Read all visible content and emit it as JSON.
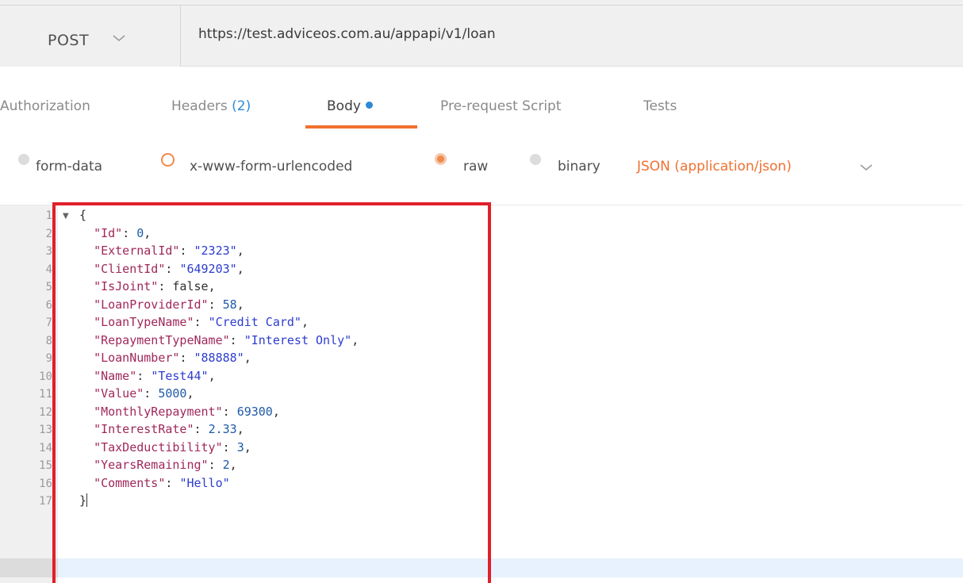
{
  "request": {
    "method": "POST",
    "url": "https://test.adviceos.com.au/appapi/v1/loan"
  },
  "tabs": [
    {
      "label": "Authorization"
    },
    {
      "label": "Headers",
      "count": "(2)"
    },
    {
      "label": "Body",
      "active": true
    },
    {
      "label": "Pre-request Script"
    },
    {
      "label": "Tests"
    }
  ],
  "body_types": {
    "form_data": "form-data",
    "urlencoded": "x-www-form-urlencoded",
    "raw": "raw",
    "binary": "binary",
    "selected": "raw",
    "content_type": "JSON (application/json)"
  },
  "editor": {
    "active_line": 17,
    "lines": [
      {
        "n": "1",
        "text": "{"
      },
      {
        "n": "2",
        "key": "\"Id\"",
        "value": "0",
        "type": "num",
        "comma": true
      },
      {
        "n": "3",
        "key": "\"ExternalId\"",
        "value": "\"2323\"",
        "type": "str",
        "comma": true
      },
      {
        "n": "4",
        "key": "\"ClientId\"",
        "value": "\"649203\"",
        "type": "str",
        "comma": true
      },
      {
        "n": "5",
        "key": "\"IsJoint\"",
        "value": "false",
        "type": "kw",
        "comma": true
      },
      {
        "n": "6",
        "key": "\"LoanProviderId\"",
        "value": "58",
        "type": "num",
        "comma": true
      },
      {
        "n": "7",
        "key": "\"LoanTypeName\"",
        "value": "\"Credit Card\"",
        "type": "str",
        "comma": true
      },
      {
        "n": "8",
        "key": "\"RepaymentTypeName\"",
        "value": "\"Interest Only\"",
        "type": "str",
        "comma": true
      },
      {
        "n": "9",
        "key": "\"LoanNumber\"",
        "value": "\"88888\"",
        "type": "str",
        "comma": true
      },
      {
        "n": "10",
        "key": "\"Name\"",
        "value": "\"Test44\"",
        "type": "str",
        "comma": true
      },
      {
        "n": "11",
        "key": "\"Value\"",
        "value": "5000",
        "type": "num",
        "comma": true
      },
      {
        "n": "12",
        "key": "\"MonthlyRepayment\"",
        "value": "69300",
        "type": "num",
        "comma": true
      },
      {
        "n": "13",
        "key": "\"InterestRate\"",
        "value": "2.33",
        "type": "num",
        "comma": true
      },
      {
        "n": "14",
        "key": "\"TaxDeductibility\"",
        "value": "3",
        "type": "num",
        "comma": true
      },
      {
        "n": "15",
        "key": "\"YearsRemaining\"",
        "value": "2",
        "type": "num",
        "comma": true
      },
      {
        "n": "16",
        "key": "\"Comments\"",
        "value": "\"Hello\"",
        "type": "str",
        "comma": false
      },
      {
        "n": "17",
        "text": "}"
      }
    ]
  },
  "colors": {
    "accent": "#f07030",
    "link_blue": "#2d8ad6",
    "annotation_red": "#e0202a"
  }
}
